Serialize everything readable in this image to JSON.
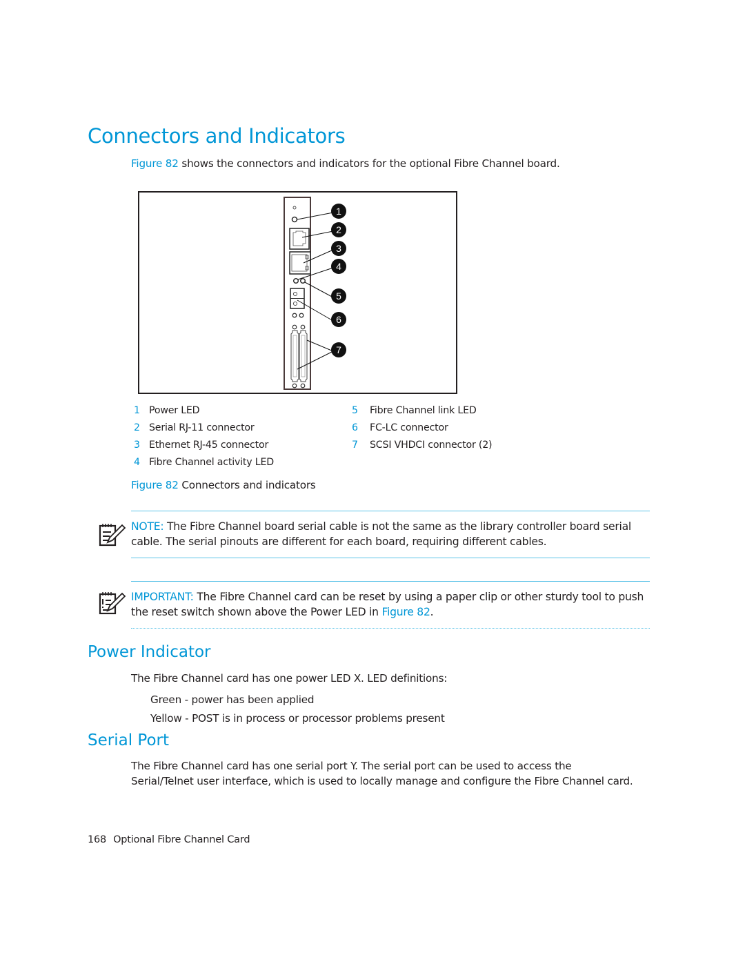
{
  "section": {
    "title": "Connectors and Indicators",
    "intro": {
      "link": "Figure 82",
      "text": " shows the connectors and indicators for the optional Fibre Channel board."
    }
  },
  "figure": {
    "callouts": [
      "1",
      "2",
      "3",
      "4",
      "5",
      "6",
      "7"
    ],
    "legend_left": [
      {
        "num": "1",
        "label": "Power LED"
      },
      {
        "num": "2",
        "label": "Serial RJ-11 connector"
      },
      {
        "num": "3",
        "label": "Ethernet RJ-45 connector"
      },
      {
        "num": "4",
        "label": "Fibre Channel activity LED"
      }
    ],
    "legend_right": [
      {
        "num": "5",
        "label": "Fibre Channel link LED"
      },
      {
        "num": "6",
        "label": "FC-LC connector"
      },
      {
        "num": "7",
        "label": "SCSI VHDCI connector (2)"
      }
    ],
    "caption_label": "Figure 82",
    "caption_text": " Connectors and indicators"
  },
  "note": {
    "label": "NOTE:",
    "text": "  The Fibre Channel board serial cable is not the same as the library controller board serial cable. The serial pinouts are different for each board, requiring different cables.",
    "icon": "note-pad-pencil-icon"
  },
  "important": {
    "label": "IMPORTANT:",
    "text_before": " The Fibre Channel card can be reset by using a paper clip or other sturdy tool to push the reset switch shown above the Power LED in ",
    "link": "Figure 82",
    "text_after": ".",
    "icon": "important-pad-pencil-icon"
  },
  "power_indicator": {
    "title": "Power Indicator",
    "intro": "The Fibre Channel card has one power LED  X. LED definitions:",
    "items": [
      "Green - power has been applied",
      "Yellow - POST is in process or processor problems present"
    ]
  },
  "serial_port": {
    "title": "Serial Port",
    "line1": "The Fibre Channel card has one serial port  Y. The serial port can be used to access the",
    "line2": "Serial/Telnet user interface, which is used to locally manage and configure the Fibre Channel card."
  },
  "footer": {
    "page_number": "168",
    "chapter": "Optional Fibre Channel Card"
  },
  "colors": {
    "accent": "#0096d6",
    "rule": "#5bc2e7",
    "text": "#231f20"
  }
}
